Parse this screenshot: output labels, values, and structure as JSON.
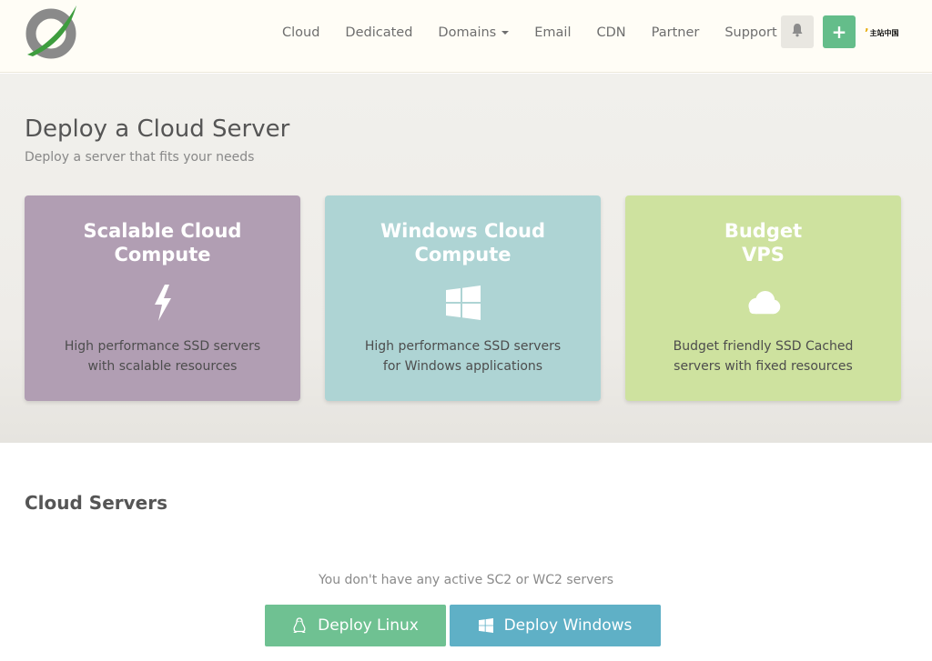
{
  "nav": {
    "links": [
      "Cloud",
      "Dedicated",
      "Domains",
      "Email",
      "CDN",
      "Partner",
      "Support"
    ],
    "plus_label": "+",
    "account_logo_text": "主站中国"
  },
  "hero": {
    "title": "Deploy a Cloud Server",
    "subtitle": "Deploy a server that fits your needs",
    "cards": [
      {
        "title": "Scalable Cloud\nCompute",
        "description": "High performance SSD servers\nwith scalable resources",
        "icon": "lightning-icon",
        "color": "#b19eb3"
      },
      {
        "title": "Windows Cloud\nCompute",
        "description": "High performance SSD servers\nfor Windows applications",
        "icon": "windows-icon",
        "color": "#aed4d4"
      },
      {
        "title": "Budget\nVPS",
        "description": "Budget friendly SSD Cached\nservers with fixed resources",
        "icon": "cloud-icon",
        "color": "#cee29f"
      }
    ]
  },
  "servers": {
    "title": "Cloud Servers",
    "empty_text": "You don't have any active SC2 or WC2 servers",
    "deploy_linux_label": "Deploy Linux",
    "deploy_windows_label": "Deploy Windows"
  },
  "colors": {
    "accent_green": "#64bd8a",
    "linux_button": "#6fc192",
    "windows_button": "#5fb0c6"
  }
}
